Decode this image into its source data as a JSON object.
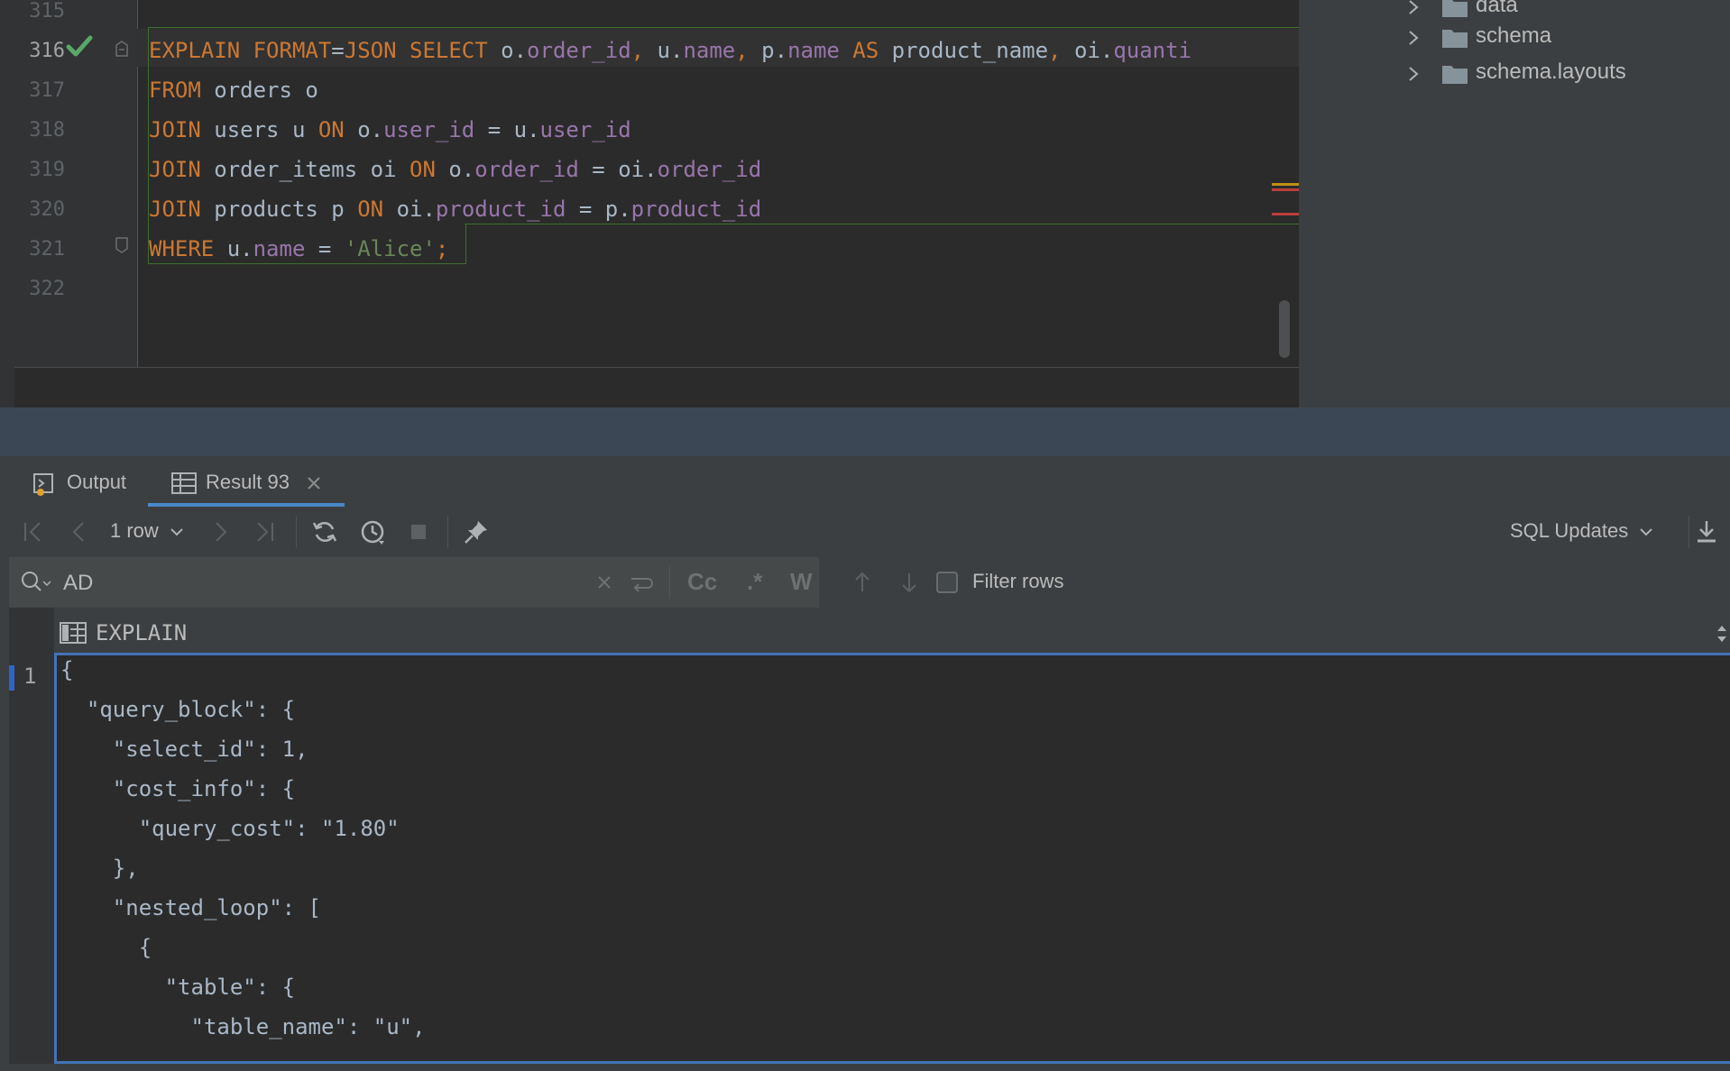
{
  "editor": {
    "lines": [
      {
        "num": "315",
        "text": ""
      },
      {
        "num": "316",
        "parts": [
          {
            "t": "EXPLAIN FORMAT",
            "c": "kw"
          },
          {
            "t": "=",
            "c": ""
          },
          {
            "t": "JSON SELECT ",
            "c": "kw"
          },
          {
            "t": "o.",
            "c": ""
          },
          {
            "t": "order_id",
            "c": "fld"
          },
          {
            "t": ", ",
            "c": "kw"
          },
          {
            "t": "u.",
            "c": ""
          },
          {
            "t": "name",
            "c": "fld"
          },
          {
            "t": ", ",
            "c": "kw"
          },
          {
            "t": "p.",
            "c": ""
          },
          {
            "t": "name",
            "c": "fld"
          },
          {
            "t": " AS ",
            "c": "kw"
          },
          {
            "t": "product_name",
            "c": ""
          },
          {
            "t": ", ",
            "c": "kw"
          },
          {
            "t": "oi.",
            "c": ""
          },
          {
            "t": "quanti",
            "c": "fld"
          }
        ]
      },
      {
        "num": "317",
        "parts": [
          {
            "t": "FROM ",
            "c": "kw"
          },
          {
            "t": "orders o",
            "c": ""
          }
        ]
      },
      {
        "num": "318",
        "parts": [
          {
            "t": "JOIN ",
            "c": "kw"
          },
          {
            "t": "users u ",
            "c": ""
          },
          {
            "t": "ON ",
            "c": "kw"
          },
          {
            "t": "o.",
            "c": ""
          },
          {
            "t": "user_id",
            "c": "fld"
          },
          {
            "t": " = u.",
            "c": ""
          },
          {
            "t": "user_id",
            "c": "fld"
          }
        ]
      },
      {
        "num": "319",
        "parts": [
          {
            "t": "JOIN ",
            "c": "kw"
          },
          {
            "t": "order_items oi ",
            "c": ""
          },
          {
            "t": "ON ",
            "c": "kw"
          },
          {
            "t": "o.",
            "c": ""
          },
          {
            "t": "order_id",
            "c": "fld"
          },
          {
            "t": " = oi.",
            "c": ""
          },
          {
            "t": "order_id",
            "c": "fld"
          }
        ]
      },
      {
        "num": "320",
        "parts": [
          {
            "t": "JOIN ",
            "c": "kw"
          },
          {
            "t": "products p ",
            "c": ""
          },
          {
            "t": "ON ",
            "c": "kw"
          },
          {
            "t": "oi.",
            "c": ""
          },
          {
            "t": "product_id",
            "c": "fld"
          },
          {
            "t": " = p.",
            "c": ""
          },
          {
            "t": "product_id",
            "c": "fld"
          }
        ]
      },
      {
        "num": "321",
        "parts": [
          {
            "t": "WHERE ",
            "c": "kw"
          },
          {
            "t": "u.",
            "c": ""
          },
          {
            "t": "name",
            "c": "fld"
          },
          {
            "t": " = ",
            "c": ""
          },
          {
            "t": "'Alice'",
            "c": "str"
          },
          {
            "t": ";",
            "c": "kw"
          }
        ]
      },
      {
        "num": "322",
        "text": ""
      }
    ]
  },
  "tree": {
    "items": [
      {
        "label": "data"
      },
      {
        "label": "schema"
      },
      {
        "label": "schema.layouts"
      }
    ]
  },
  "tabs": {
    "output_label": "Output",
    "result_label": "Result 93"
  },
  "toolbar": {
    "rows_label": "1 row",
    "sql_updates_label": "SQL Updates"
  },
  "search": {
    "value": "AD",
    "cc_label": "Cc",
    "regex_label": ".*",
    "words_label": "W",
    "filter_rows_label": "Filter rows"
  },
  "result": {
    "column_header": "EXPLAIN",
    "row_number": "1",
    "json_lines": [
      "{",
      "  \"query_block\": {",
      "    \"select_id\": 1,",
      "    \"cost_info\": {",
      "      \"query_cost\": \"1.80\"",
      "    },",
      "    \"nested_loop\": [",
      "      {",
      "        \"table\": {",
      "          \"table_name\": \"u\","
    ]
  },
  "colors": {
    "keyword": "#cc7832",
    "field": "#9876aa",
    "string": "#6a8759",
    "accent": "#4a88c7"
  }
}
